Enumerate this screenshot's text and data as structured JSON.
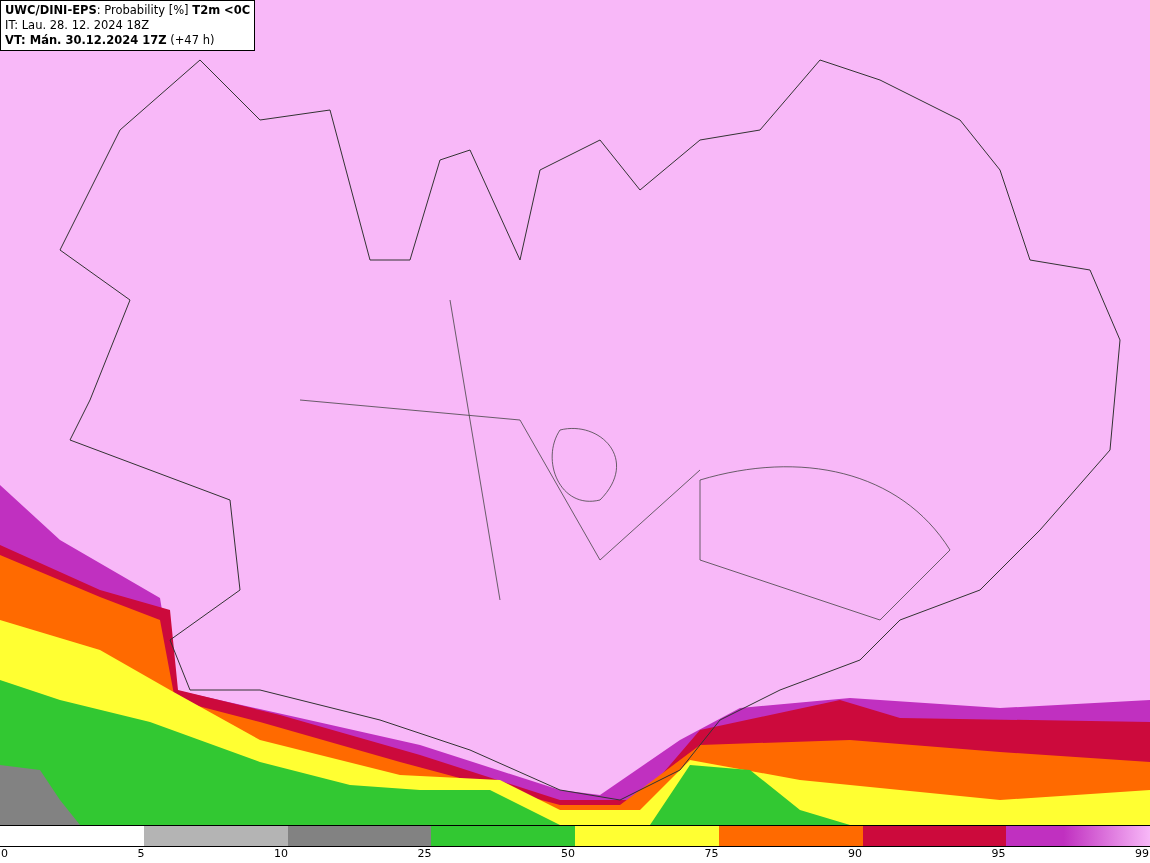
{
  "header": {
    "lines": [
      "**UWC/DINI-EPS**: Probability [%] **T2m <0C**",
      "IT: Lau. 28. 12. 2024 18Z",
      "**VT: Mán. 30.12.2024 17Z** (+47 h)"
    ]
  },
  "legend": {
    "segments": [
      {
        "color": "#b4b4b4"
      },
      {
        "color": "#828282"
      },
      {
        "color": "#32c832"
      },
      {
        "color": "#ffff32"
      },
      {
        "color": "#ff6a00"
      },
      {
        "color": "#cc0a3c"
      },
      {
        "color": "#c030c0",
        "kind": "fade"
      }
    ],
    "labels": [
      "0",
      "5",
      "10",
      "25",
      "50",
      "75",
      "90",
      "95",
      "99"
    ]
  }
}
